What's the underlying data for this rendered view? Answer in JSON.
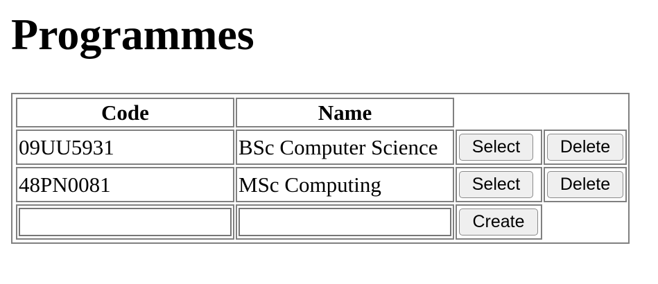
{
  "page": {
    "title": "Programmes"
  },
  "table": {
    "headers": {
      "code": "Code",
      "name": "Name"
    },
    "rows": [
      {
        "code": "09UU5931",
        "name": "BSc Computer Science",
        "select_label": "Select",
        "delete_label": "Delete"
      },
      {
        "code": "48PN0081",
        "name": "MSc Computing",
        "select_label": "Select",
        "delete_label": "Delete"
      }
    ],
    "new_row": {
      "code_value": "",
      "name_value": "",
      "create_label": "Create"
    }
  }
}
